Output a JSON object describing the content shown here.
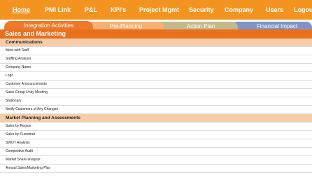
{
  "nav": {
    "items": [
      {
        "label": "Home",
        "active": true
      },
      {
        "label": "PMI Link"
      },
      {
        "label": "P&L"
      },
      {
        "label": "KPI's"
      },
      {
        "label": "Project Mgmt"
      },
      {
        "label": "Security"
      },
      {
        "label": "Company"
      },
      {
        "label": "Users"
      },
      {
        "label": "Logou"
      }
    ]
  },
  "tabs": [
    {
      "label": "Integration Activities"
    },
    {
      "label": "Pre-Planning"
    },
    {
      "label": "Action Plan"
    },
    {
      "label": "Financial Impact"
    }
  ],
  "section_title": "Sales and Marketing",
  "categories": [
    {
      "title": "Communications",
      "rows": [
        "Meet with Staff",
        "Staffing Analysis",
        "Company Name",
        "Logo",
        "Customer Announcements",
        "Sales Group Unity Meeting",
        "Stationary",
        "Notify Customers of Any Changes"
      ]
    },
    {
      "title": "Market Planning and Assessments",
      "rows": [
        "Sales by Region",
        "Sales by Customer",
        "SWOT Analysis",
        "Competitive Audit",
        "Market Share analysis",
        "Annual Sales/Marketing Plan"
      ]
    }
  ],
  "colors": {
    "nav_bg": "#f49420",
    "section_bg": "#e9701d",
    "category_bg": "#f6cda9",
    "tab_integration": "#ec7a2c",
    "tab_preplanning": "#f6b073",
    "tab_actionplan": "#c3b98c",
    "tab_financial": "#7f95c8"
  }
}
